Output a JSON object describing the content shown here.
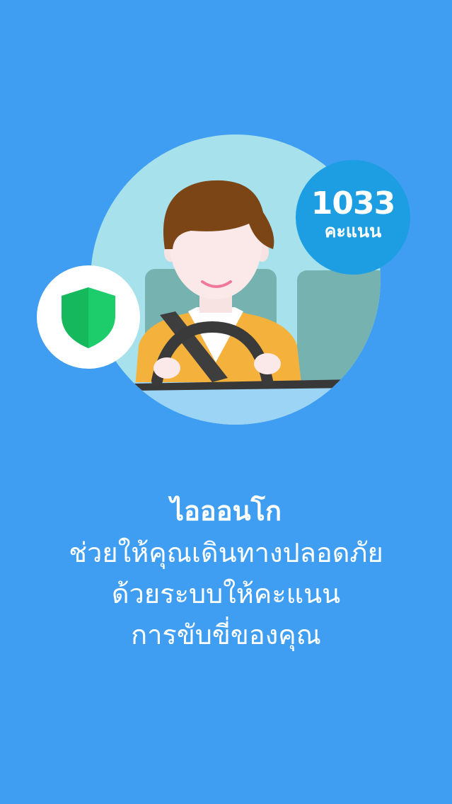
{
  "score": {
    "value": "1033",
    "unit": "คะแนน"
  },
  "icons": {
    "safety": "shield-icon",
    "driver": "driver-illustration",
    "steering": "steering-wheel-icon"
  },
  "colors": {
    "background": "#3f9ef1",
    "score_badge": "#1d9ee2",
    "scene_circle": "#a6e1ec",
    "shield": "#1dcc6a",
    "jacket": "#f4b23c",
    "hair": "#7b4515"
  },
  "tagline": {
    "title": "ไอออนโก",
    "line1": "ช่วยให้คุณเดินทางปลอดภัย",
    "line2": "ด้วยระบบให้คะแนน",
    "line3": "การขับขี่ของคุณ"
  }
}
